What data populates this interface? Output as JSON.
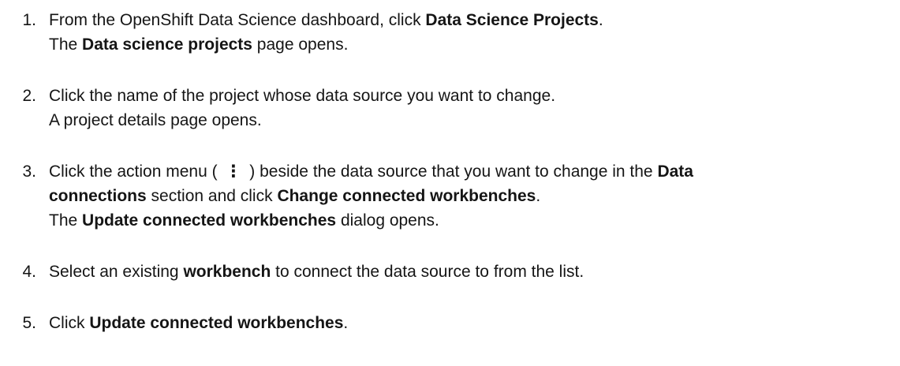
{
  "steps": [
    {
      "number": "1.",
      "lines": [
        [
          {
            "text": "From the OpenShift Data Science dashboard, click ",
            "bold": false
          },
          {
            "text": "Data Science Projects",
            "bold": true
          },
          {
            "text": ".",
            "bold": false
          }
        ],
        [
          {
            "text": "The ",
            "bold": false
          },
          {
            "text": "Data science projects",
            "bold": true
          },
          {
            "text": " page opens.",
            "bold": false
          }
        ]
      ]
    },
    {
      "number": "2.",
      "lines": [
        [
          {
            "text": "Click the name of the project whose data source you want to change.",
            "bold": false
          }
        ],
        [
          {
            "text": "A project details page opens.",
            "bold": false
          }
        ]
      ]
    },
    {
      "number": "3.",
      "lines": [
        [
          {
            "text": "Click the action menu ( ",
            "bold": false
          },
          {
            "text": "⋮",
            "bold": true,
            "icon": "kebab-menu-icon"
          },
          {
            "text": " ) beside the data source that you want to change in the ",
            "bold": false
          },
          {
            "text": "Data",
            "bold": true
          }
        ],
        [
          {
            "text": "connections",
            "bold": true
          },
          {
            "text": " section and click ",
            "bold": false
          },
          {
            "text": "Change connected workbenches",
            "bold": true
          },
          {
            "text": ".",
            "bold": false
          }
        ],
        [
          {
            "text": "The ",
            "bold": false
          },
          {
            "text": "Update connected workbenches",
            "bold": true
          },
          {
            "text": " dialog opens.",
            "bold": false
          }
        ]
      ]
    },
    {
      "number": "4.",
      "lines": [
        [
          {
            "text": "Select an existing ",
            "bold": false
          },
          {
            "text": "workbench",
            "bold": true
          },
          {
            "text": " to connect the data source to from the list.",
            "bold": false
          }
        ]
      ]
    },
    {
      "number": "5.",
      "lines": [
        [
          {
            "text": "Click ",
            "bold": false
          },
          {
            "text": "Update connected workbenches",
            "bold": true
          },
          {
            "text": ".",
            "bold": false
          }
        ]
      ]
    }
  ]
}
